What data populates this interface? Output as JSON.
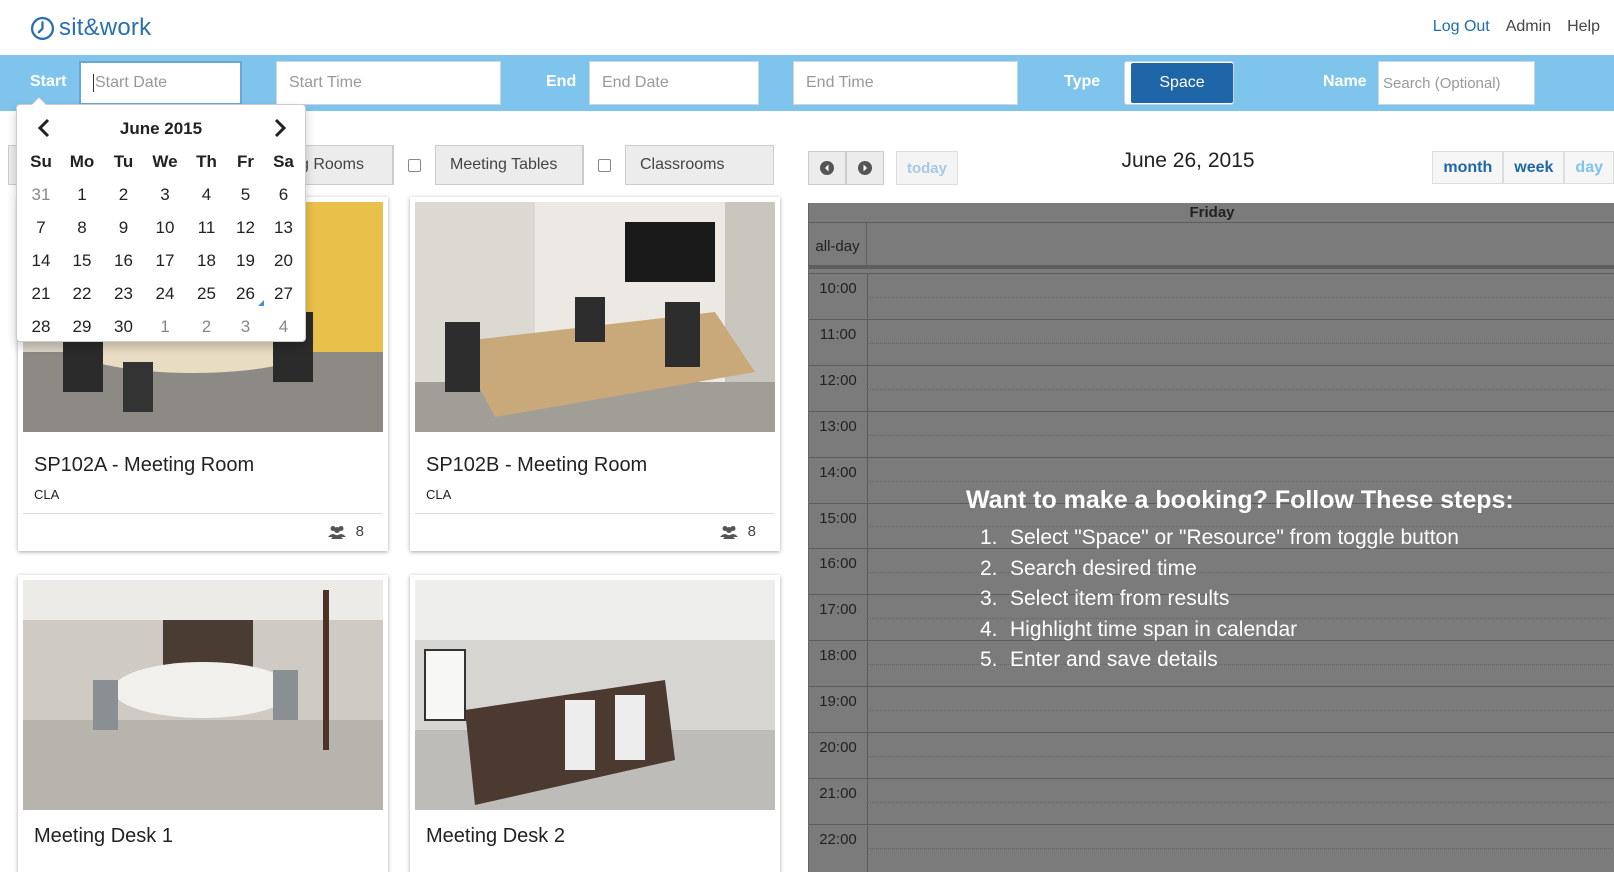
{
  "brand": {
    "name": "sit&work"
  },
  "topnav": {
    "logout": "Log Out",
    "admin": "Admin",
    "help": "Help"
  },
  "search": {
    "start_label": "Start",
    "start_date_placeholder": "Start Date",
    "start_time_placeholder": "Start Time",
    "end_label": "End",
    "end_date_placeholder": "End Date",
    "end_time_placeholder": "End Time",
    "type_label": "Type",
    "type_value": "Space",
    "name_label": "Name",
    "name_placeholder": "Search (Optional)"
  },
  "filters": [
    {
      "label": "g Rooms",
      "checked": false
    },
    {
      "label": "Meeting Tables",
      "checked": false
    },
    {
      "label": "Classrooms",
      "checked": false
    }
  ],
  "datepicker": {
    "title": "June 2015",
    "dow": [
      "Su",
      "Mo",
      "Tu",
      "We",
      "Th",
      "Fr",
      "Sa"
    ],
    "weeks": [
      [
        "31",
        "1",
        "2",
        "3",
        "4",
        "5",
        "6"
      ],
      [
        "7",
        "8",
        "9",
        "10",
        "11",
        "12",
        "13"
      ],
      [
        "14",
        "15",
        "16",
        "17",
        "18",
        "19",
        "20"
      ],
      [
        "21",
        "22",
        "23",
        "24",
        "25",
        "26",
        "27"
      ],
      [
        "28",
        "29",
        "30",
        "1",
        "2",
        "3",
        "4"
      ]
    ],
    "today": "26"
  },
  "cards": [
    {
      "title": "SP102A - Meeting Room",
      "sub": "CLA",
      "capacity": "8"
    },
    {
      "title": "SP102B - Meeting Room",
      "sub": "CLA",
      "capacity": "8"
    },
    {
      "title": "Meeting Desk 1",
      "sub": "",
      "capacity": ""
    },
    {
      "title": "Meeting Desk 2",
      "sub": "",
      "capacity": ""
    }
  ],
  "calendar": {
    "today_label": "today",
    "title": "June 26, 2015",
    "views": {
      "month": "month",
      "week": "week",
      "day": "day"
    },
    "day_header": "Friday",
    "allday_label": "all-day",
    "hours": [
      "10:00",
      "11:00",
      "12:00",
      "13:00",
      "14:00",
      "15:00",
      "16:00",
      "17:00",
      "18:00",
      "19:00",
      "20:00",
      "21:00",
      "22:00"
    ],
    "instructions": {
      "heading": "Want to make a booking? Follow These steps:",
      "steps": [
        {
          "n": "1.",
          "text": "Select \"Space\" or \"Resource\" from toggle button"
        },
        {
          "n": "2.",
          "text": "Search desired time"
        },
        {
          "n": "3.",
          "text": "Select item from results"
        },
        {
          "n": "4.",
          "text": "Highlight time span in calendar"
        },
        {
          "n": "5.",
          "text": "Enter and save details"
        }
      ]
    }
  },
  "colors": {
    "accent": "#1e66a8",
    "searchbar": "#7fc4ec",
    "calendar_overlay": "#7b7b7b"
  }
}
